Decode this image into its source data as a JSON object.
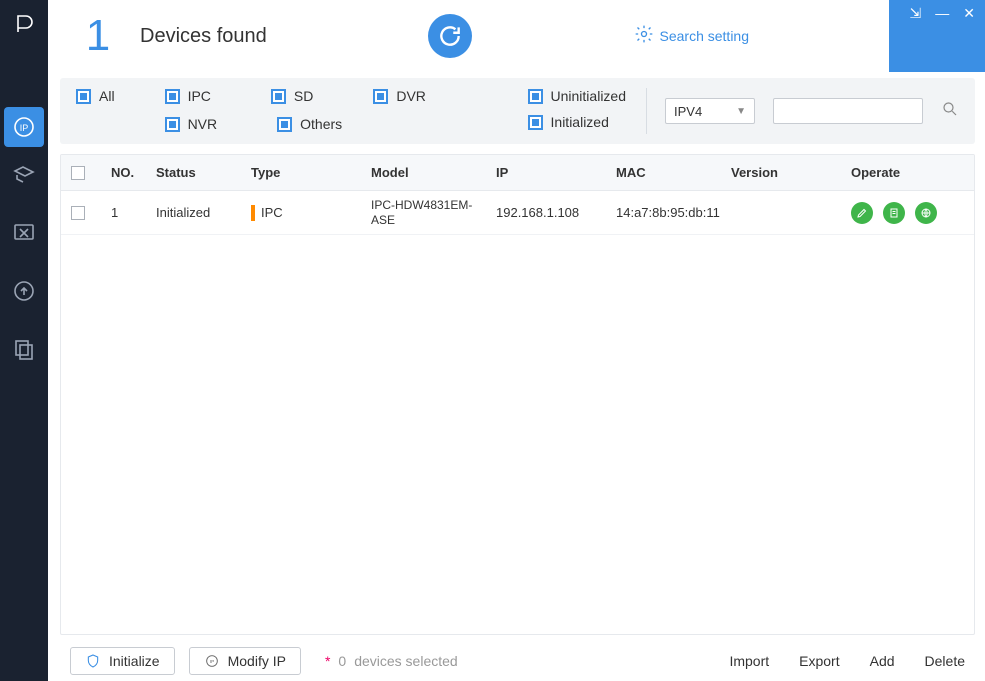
{
  "header": {
    "count": "1",
    "found_label": "Devices found",
    "search_setting_label": "Search setting"
  },
  "window_controls": {
    "pin": "⇲",
    "minimize": "—",
    "close": "✕"
  },
  "filters": {
    "all": "All",
    "ipc": "IPC",
    "sd": "SD",
    "dvr": "DVR",
    "nvr": "NVR",
    "others": "Others",
    "uninitialized": "Uninitialized",
    "initialized": "Initialized",
    "protocol_selected": "IPV4",
    "search_value": ""
  },
  "table": {
    "headers": {
      "no": "NO.",
      "status": "Status",
      "type": "Type",
      "model": "Model",
      "ip": "IP",
      "mac": "MAC",
      "version": "Version",
      "operate": "Operate"
    },
    "rows": [
      {
        "no": "1",
        "status": "Initialized",
        "type": "IPC",
        "model": "IPC-HDW4831EM-ASE",
        "ip": "192.168.1.108",
        "mac": "14:a7:8b:95:db:11",
        "version": ""
      }
    ]
  },
  "footer": {
    "initialize": "Initialize",
    "modify_ip": "Modify IP",
    "selected_count": "0",
    "selected_label": "devices selected",
    "import": "Import",
    "export": "Export",
    "add": "Add",
    "delete": "Delete"
  }
}
